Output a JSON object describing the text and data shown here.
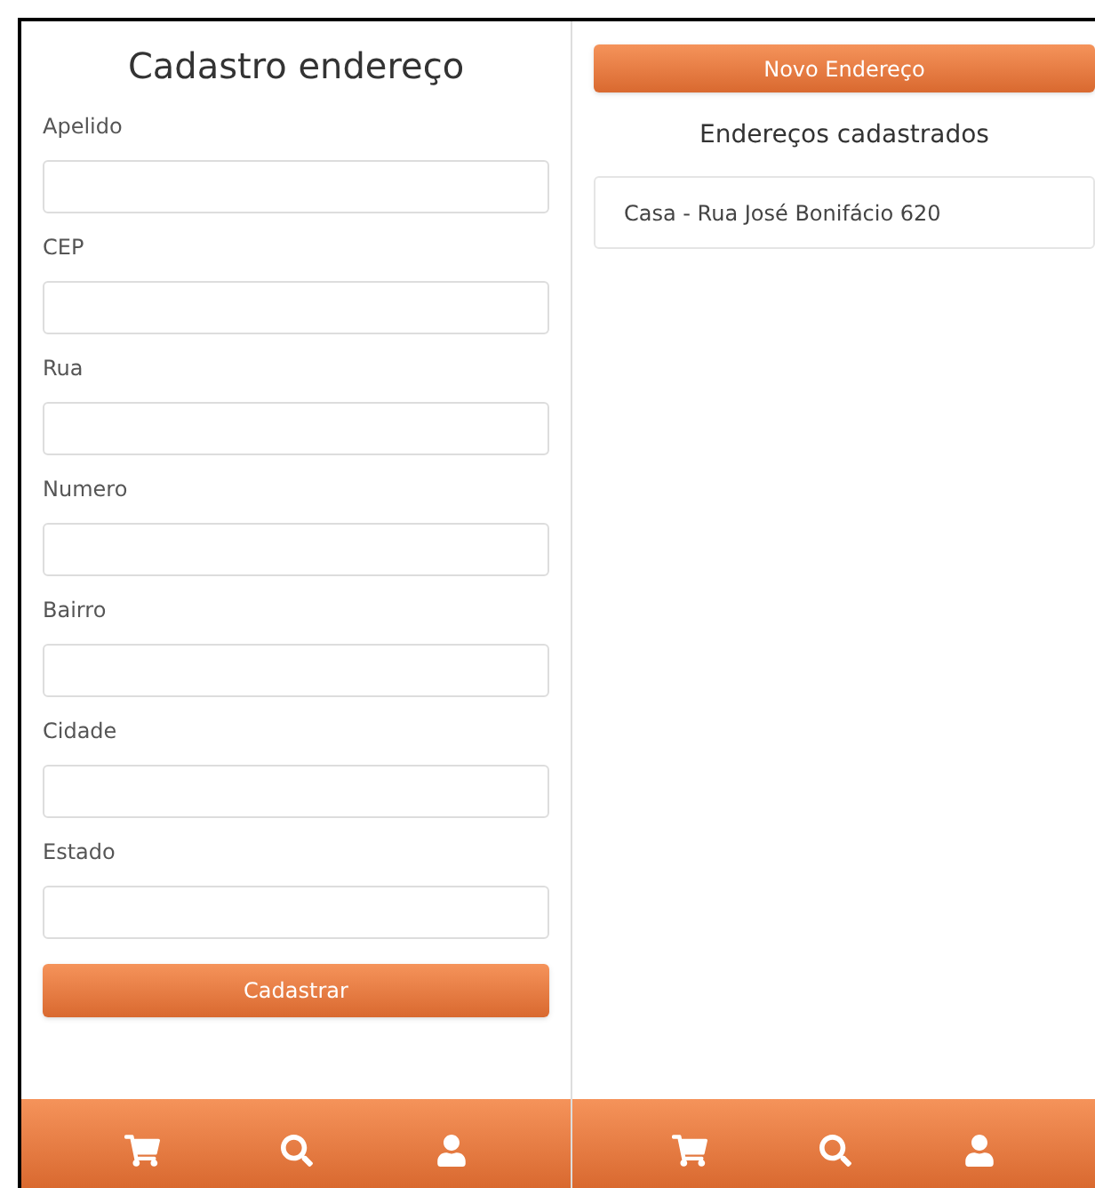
{
  "form_panel": {
    "title": "Cadastro endereço",
    "fields": [
      {
        "label": "Apelido"
      },
      {
        "label": "CEP"
      },
      {
        "label": "Rua"
      },
      {
        "label": "Numero"
      },
      {
        "label": "Bairro"
      },
      {
        "label": "Cidade"
      },
      {
        "label": "Estado"
      }
    ],
    "submit_button": "Cadastrar"
  },
  "list_panel": {
    "new_button": "Novo Endereço",
    "title": "Endereços cadastrados",
    "addresses": [
      "Casa - Rua José Bonifácio 620"
    ]
  }
}
